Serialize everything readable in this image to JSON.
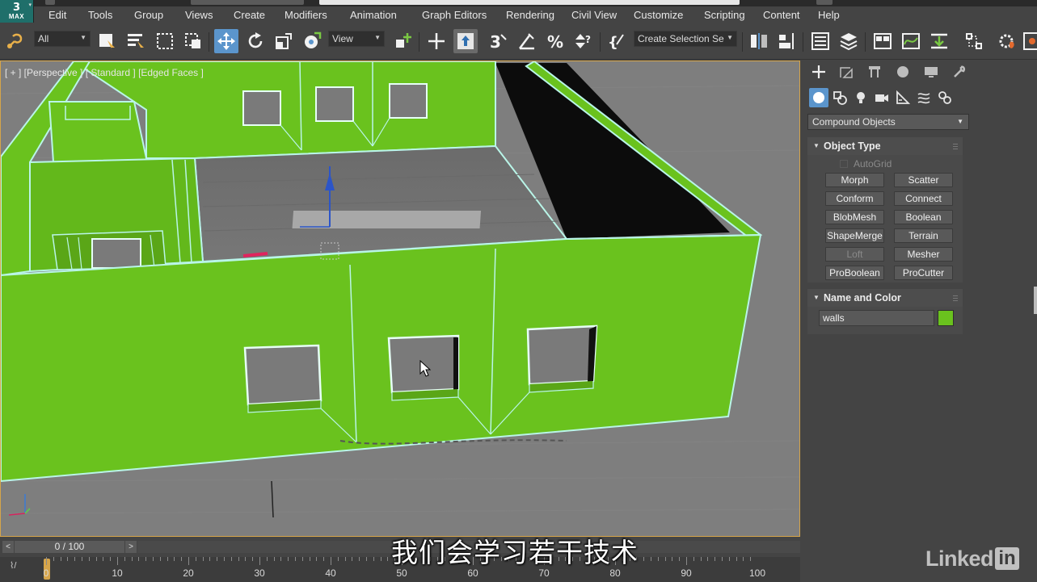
{
  "app": {
    "logo_number": "3",
    "logo_text": "MAX"
  },
  "menu": {
    "items": [
      "Edit",
      "Tools",
      "Group",
      "Views",
      "Create",
      "Modifiers",
      "Animation",
      "Graph Editors",
      "Rendering",
      "Civil View",
      "Customize",
      "Scripting",
      "Content",
      "Help"
    ]
  },
  "toolbar": {
    "selection_filter": "All",
    "reference_coord": "View",
    "named_selection": "Create Selection Se",
    "icons": {
      "link": "link-icon",
      "select": "select-object-icon",
      "select_by_name": "select-by-name-icon",
      "region": "rectangular-selection-icon",
      "window_crossing": "window-crossing-icon",
      "move": "select-and-move-icon",
      "rotate": "select-and-rotate-icon",
      "scale": "select-and-scale-icon",
      "place": "select-and-place-icon",
      "pivot": "use-pivot-center-icon",
      "manipulate": "select-and-manipulate-icon",
      "keyboard_shortcut": "keyboard-shortcut-override-icon",
      "snap3": "snaps-toggle-icon",
      "angle_snap": "angle-snap-icon",
      "percent_snap": "percent-snap-icon",
      "spinner_snap": "spinner-snap-icon",
      "edit_named_sets": "edit-named-selection-sets-icon",
      "mirror": "mirror-icon",
      "align": "align-icon",
      "layer_explorer": "scene-explorer-icon",
      "layers": "layer-manager-icon",
      "ribbon": "toggle-ribbon-icon",
      "curve_editor": "curve-editor-icon",
      "schematic": "schematic-view-icon",
      "material": "material-editor-icon",
      "render_setup": "render-setup-icon"
    }
  },
  "viewport": {
    "label": "[ + ] [Perspective ] [ Standard ] [Edged Faces ]",
    "model_color": "#6ac21e",
    "edge_color": "#b9f5e8"
  },
  "command_panel": {
    "category": "Compound Objects",
    "object_type": {
      "title": "Object Type",
      "autogrid": "AutoGrid",
      "buttons": [
        {
          "label": "Morph",
          "enabled": true
        },
        {
          "label": "Scatter",
          "enabled": true
        },
        {
          "label": "Conform",
          "enabled": true
        },
        {
          "label": "Connect",
          "enabled": true
        },
        {
          "label": "BlobMesh",
          "enabled": true
        },
        {
          "label": "Boolean",
          "enabled": true
        },
        {
          "label": "ShapeMerge",
          "enabled": true
        },
        {
          "label": "Terrain",
          "enabled": true
        },
        {
          "label": "Loft",
          "enabled": false
        },
        {
          "label": "Mesher",
          "enabled": true
        },
        {
          "label": "ProBoolean",
          "enabled": true
        },
        {
          "label": "ProCutter",
          "enabled": true
        }
      ]
    },
    "name_and_color": {
      "title": "Name and Color",
      "name": "walls",
      "color": "#6ac21e"
    }
  },
  "timeline": {
    "frame_display": "0 / 100",
    "prev": "<",
    "next": ">",
    "ticks": [
      "0",
      "10",
      "20",
      "30",
      "40",
      "50",
      "60",
      "70",
      "80",
      "90",
      "100"
    ]
  },
  "subtitle": "我们会学习若干技术",
  "watermark": {
    "text": "Linked",
    "box": "in"
  }
}
